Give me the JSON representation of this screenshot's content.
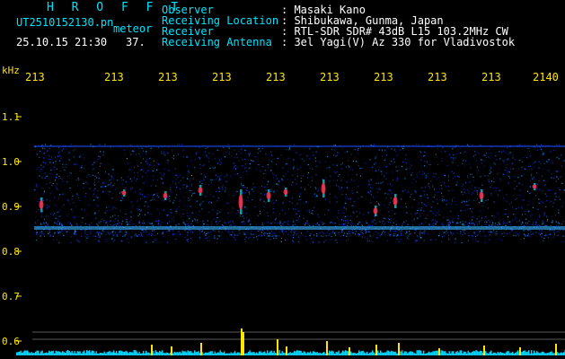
{
  "header": {
    "brand": "H R O F F T",
    "filename": "UT2510152130.pn",
    "mode": "meteor",
    "datetime": "25.10.15 21:30",
    "count": "37.",
    "rows": [
      {
        "label": "Observer",
        "value": ": Masaki Kano"
      },
      {
        "label": "Receiving Location",
        "value": ": Shibukawa, Gunma, Japan"
      },
      {
        "label": "Receiver",
        "value": ": RTL-SDR SDR# 43dB L15 103.2MHz CW"
      },
      {
        "label": "Receiving Antenna",
        "value": ": 3el Yagi(V) Az 330 for Vladivostok"
      }
    ]
  },
  "axis": {
    "unit": "kHz",
    "time_labels": [
      "213",
      "213",
      "213",
      "213",
      "213",
      "213",
      "213",
      "213",
      "213",
      "2140"
    ],
    "freq_ticks": [
      "1.1",
      "1.0",
      "0.9",
      "0.8",
      "0.7",
      "0.6"
    ]
  },
  "colors": {
    "label": "#00e5ff",
    "value": "#ffffff",
    "axis": "#ffe600",
    "signal_bar": "#ffe600",
    "noise_floor": "#00d8ff",
    "spectro_bg": "#000000"
  }
}
